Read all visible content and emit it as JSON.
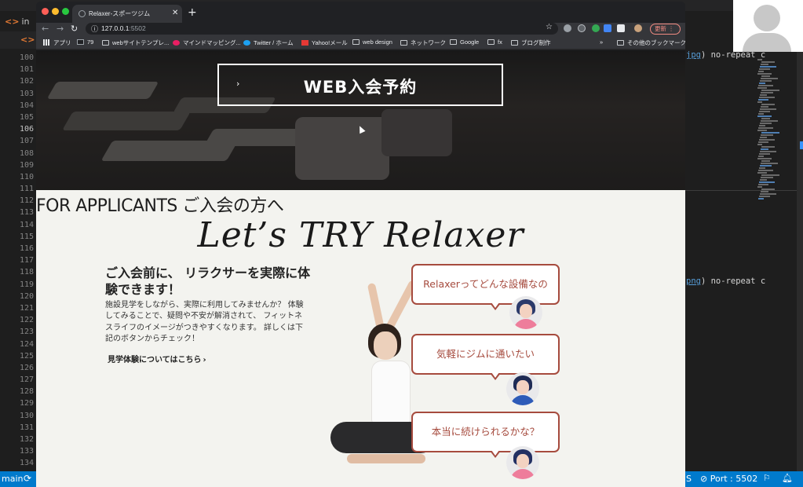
{
  "editor": {
    "file_tab_1": "in",
    "file_tab_2": "in",
    "line_numbers": [
      "100",
      "101",
      "102",
      "103",
      "104",
      "105",
      "106",
      "107",
      "108",
      "109",
      "110",
      "111",
      "112",
      "113",
      "114",
      "115",
      "116",
      "117",
      "118",
      "119",
      "120",
      "121",
      "122",
      "123",
      "124",
      "125",
      "126",
      "127",
      "128",
      "129",
      "130",
      "131",
      "132",
      "133",
      "134"
    ],
    "active_line": "106",
    "code_fragment_1": {
      "keyword": "jpg",
      "rest": ") no-repeat c"
    },
    "code_fragment_2": {
      "keyword": "png",
      "rest": ") no-repeat c"
    }
  },
  "status_bar": {
    "branch": "main",
    "sync_icon": "sync-icon",
    "problems_letter": "S",
    "port": "Port : 5502",
    "feedback_icon": "feedback-icon",
    "bell_icon": "bell-icon",
    "color": "#007acc"
  },
  "browser": {
    "tab_title": "Relaxer-スポーツジム",
    "new_tab": "+",
    "url_host": "127.0.0.1",
    "url_port": ":5502",
    "update_button": "更新",
    "more_menu": "⋮",
    "bookmarks": [
      {
        "label": "アプリ",
        "icon": "apps-grid-icon"
      },
      {
        "label": "79",
        "icon": "m-icon"
      },
      {
        "label": "webサイトテンプレ...",
        "icon": "folder-icon"
      },
      {
        "label": "マインドマッピング...",
        "icon": "mindmap-icon"
      },
      {
        "label": "Twitter / ホーム",
        "icon": "twitter-icon"
      },
      {
        "label": "Yahoo!メール",
        "icon": "yahoo-icon"
      },
      {
        "label": "web design",
        "icon": "folder-icon"
      },
      {
        "label": "ネットワーク",
        "icon": "folder-icon"
      },
      {
        "label": "Google",
        "icon": "folder-icon"
      },
      {
        "label": "fx",
        "icon": "folder-icon"
      },
      {
        "label": "ブログ制作",
        "icon": "folder-icon"
      }
    ],
    "bookmarks_overflow": "»",
    "other_bookmarks": "その他のブックマーク"
  },
  "page": {
    "hero_button": {
      "arrow": "›",
      "label": "WEB入会予約"
    },
    "section_heading": "FOR APPLICANTS ご入会の方へ",
    "script_title": "Let’s TRY Relaxer",
    "intro_heading": "ご入会前に、 リラクサーを実際に体験できます！",
    "intro_body": "施設見学をしながら、実際に利用してみませんか？ 体験してみることで、疑問や不安が解消されて、 フィットネスライフのイメージがつきやすくなります。 詳しくは下記のボタンからチェック！",
    "tour_link": "見学体験についてはこちら",
    "tour_link_chevron": "›",
    "bubbles": [
      {
        "text": "Relaxerってどんな設備なの",
        "avatar_hair": "#2b3a6b",
        "avatar_body": "#ee7d9b"
      },
      {
        "text": "気軽にジムに通いたい",
        "avatar_hair": "#1f2b55",
        "avatar_body": "#2e5bb8"
      },
      {
        "text": "本当に続けられるかな？",
        "avatar_hair": "#233063",
        "avatar_body": "#ee7d9b"
      }
    ],
    "accent_color": "#a64b3e",
    "background_color": "#f3f3ef"
  }
}
